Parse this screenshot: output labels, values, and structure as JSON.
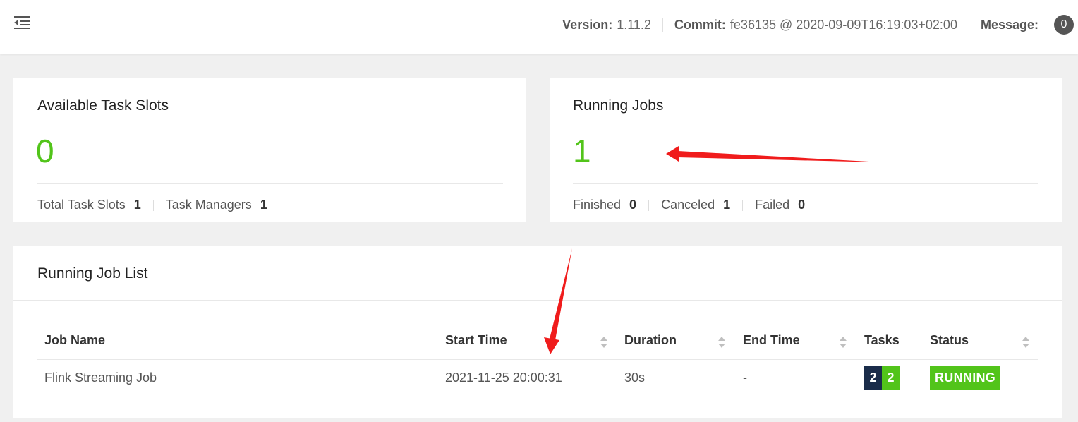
{
  "header": {
    "version_label": "Version:",
    "version_value": "1.11.2",
    "commit_label": "Commit:",
    "commit_value": "fe36135 @ 2020-09-09T16:19:03+02:00",
    "message_label": "Message:",
    "message_count": "0"
  },
  "task_slots_card": {
    "title": "Available Task Slots",
    "value": "0",
    "total_label": "Total Task Slots",
    "total_value": "1",
    "managers_label": "Task Managers",
    "managers_value": "1"
  },
  "running_jobs_card": {
    "title": "Running Jobs",
    "value": "1",
    "finished_label": "Finished",
    "finished_value": "0",
    "canceled_label": "Canceled",
    "canceled_value": "1",
    "failed_label": "Failed",
    "failed_value": "0"
  },
  "job_list": {
    "title": "Running Job List",
    "columns": {
      "job_name": "Job Name",
      "start_time": "Start Time",
      "duration": "Duration",
      "end_time": "End Time",
      "tasks": "Tasks",
      "status": "Status"
    },
    "rows": [
      {
        "job_name": "Flink Streaming Job",
        "start_time": "2021-11-25 20:00:31",
        "duration": "30s",
        "end_time": "-",
        "tasks_running": "2",
        "tasks_total": "2",
        "status": "RUNNING"
      }
    ]
  },
  "colors": {
    "accent_green": "#52c41a",
    "running_task_navy": "#1a2c4a",
    "annotation_red": "#f01c1c"
  },
  "icons": {
    "menu_toggle": "menu-fold-icon",
    "sort": "sort-caret-icon"
  }
}
